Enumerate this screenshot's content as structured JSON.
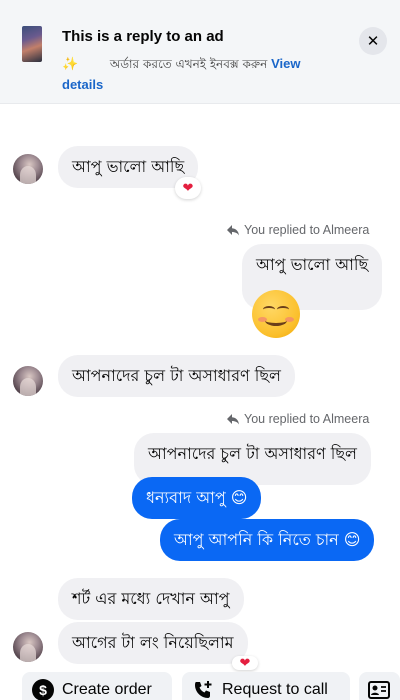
{
  "ad_banner": {
    "title": "This is a reply to an ad",
    "spark": "✨",
    "description": "   অর্ডার করতে এখনই ইনবক্স করুন ",
    "view_link": "View details"
  },
  "messages": {
    "m1": "আপু ভালো আছি",
    "m1_reaction": "❤",
    "m2_replied_label": "You replied to Almeera",
    "m2_quote": "আপু ভালো আছি",
    "m3": "আপনাদের চুল টা অসাধারণ ছিল",
    "m4_replied_label": "You replied to Almeera",
    "m4_quote": "আপনাদের চুল টা অসাধারণ ছিল",
    "m5": "ধন্যবাদ আপু 😊",
    "m6": "আপু আপনি কি নিতে চান 😊",
    "m7": "শর্ট এর মধ্যে দেখান আপু",
    "m8": "আগের টা লং নিয়েছিলাম",
    "m8_reaction": "❤"
  },
  "actions": {
    "create_order": "Create order",
    "request_call": "Request to call"
  },
  "colors": {
    "outgoing_bubble": "#0a68f4",
    "incoming_bubble": "#f0f0f3",
    "link": "#1a66c9"
  }
}
